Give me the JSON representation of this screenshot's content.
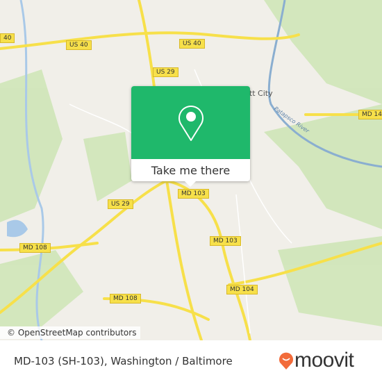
{
  "map": {
    "shields": [
      {
        "id": "us40-a",
        "label": "US 40"
      },
      {
        "id": "us40-b",
        "label": "US 40"
      },
      {
        "id": "us40-left",
        "label": "40"
      },
      {
        "id": "us29-a",
        "label": "US 29"
      },
      {
        "id": "us29-b",
        "label": "US 29"
      },
      {
        "id": "md103-a",
        "label": "MD 103"
      },
      {
        "id": "md103-b",
        "label": "MD 103"
      },
      {
        "id": "md104",
        "label": "MD 104"
      },
      {
        "id": "md108-a",
        "label": "MD 108"
      },
      {
        "id": "md108-b",
        "label": "MD 108"
      },
      {
        "id": "md14",
        "label": "MD 14"
      }
    ],
    "river_label": "Patapsco River",
    "place_label": "Ellicott City",
    "attribution": "© OpenStreetMap contributors",
    "colors": {
      "land": "#f1efe9",
      "park": "#cfe6b8",
      "water": "#a9c9e8",
      "road": "#f7e04a"
    }
  },
  "popup": {
    "icon": "map-pin-icon",
    "button_label": "Take me there",
    "color": "#1fb86b"
  },
  "footer": {
    "title": "MD-103 (SH-103), Washington / Baltimore",
    "logo_text": "moovit",
    "logo_color": "#f26b3a"
  }
}
